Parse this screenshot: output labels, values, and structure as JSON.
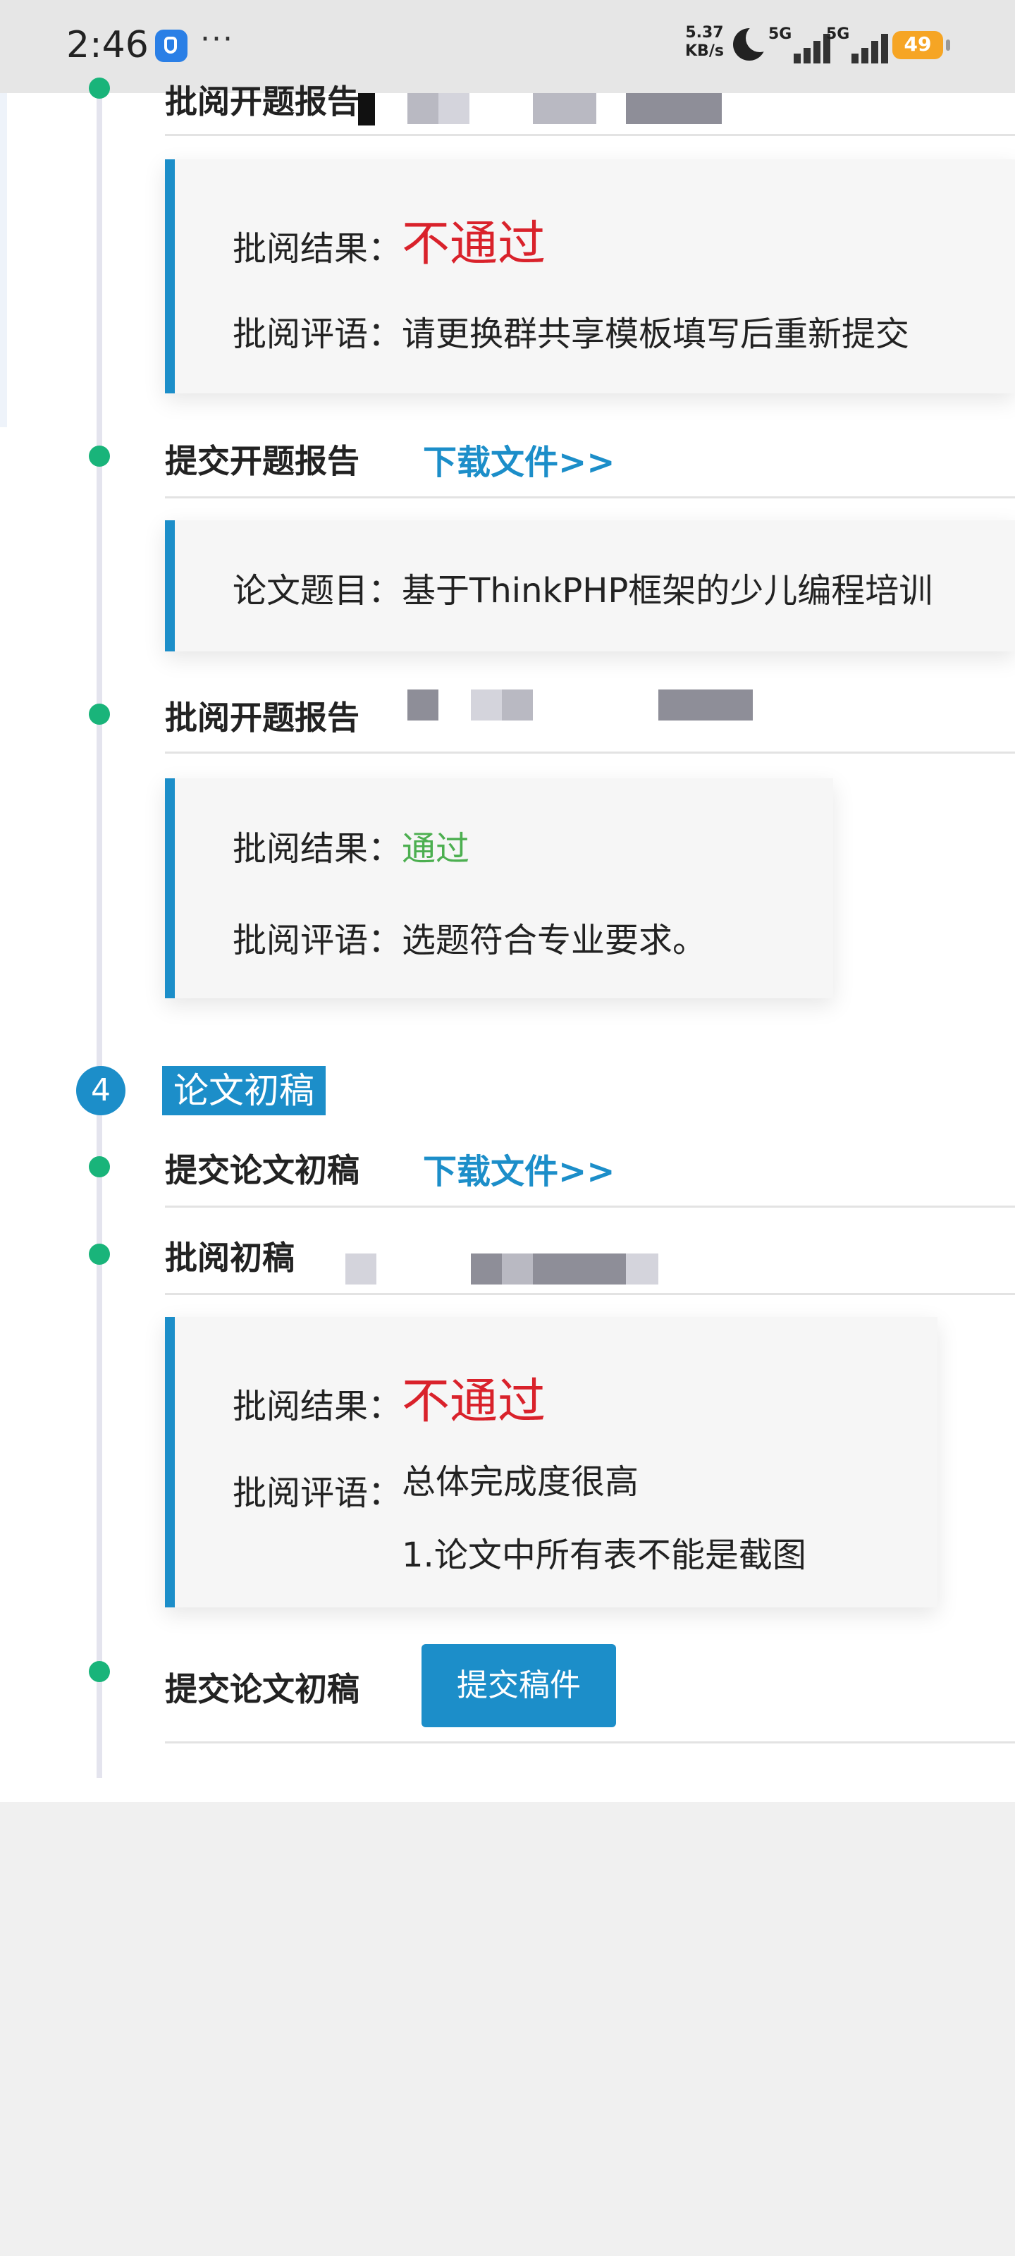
{
  "status_bar": {
    "time": "2:46",
    "more": "···",
    "net_speed_value": "5.37",
    "net_speed_unit": "KB/s",
    "signal1_label": "5G",
    "signal2_label": "5G",
    "battery": "49"
  },
  "timeline": {
    "entry0": {
      "title": "批阅开题报告"
    },
    "card0": {
      "result_label": "批阅结果：",
      "result_value": "不通过",
      "comment_label": "批阅评语：",
      "comment_value": "请更换群共享模板填写后重新提交"
    },
    "entry1": {
      "title": "提交开题报告",
      "link": "下载文件>>"
    },
    "card1": {
      "topic_label": "论文题目：",
      "topic_value": "基于ThinkPHP框架的少儿编程培训"
    },
    "entry2": {
      "title": "批阅开题报告"
    },
    "card2": {
      "result_label": "批阅结果：",
      "result_value": "通过",
      "comment_label": "批阅评语：",
      "comment_value": "选题符合专业要求。"
    },
    "step4": {
      "number": "4",
      "title": "论文初稿"
    },
    "entry3": {
      "title": "提交论文初稿",
      "link": "下载文件>>"
    },
    "entry4": {
      "title": "批阅初稿"
    },
    "card3": {
      "result_label": "批阅结果：",
      "result_value": "不通过",
      "comment_label": "批阅评语：",
      "comment_line1": "总体完成度很高",
      "comment_line2": "1.论文中所有表不能是截图"
    },
    "entry5": {
      "title": "提交论文初稿",
      "button": "提交稿件"
    }
  },
  "colors": {
    "accent": "#1c8ec9",
    "dot": "#19b47a",
    "fail": "#d9222b",
    "pass": "#4caf50"
  }
}
